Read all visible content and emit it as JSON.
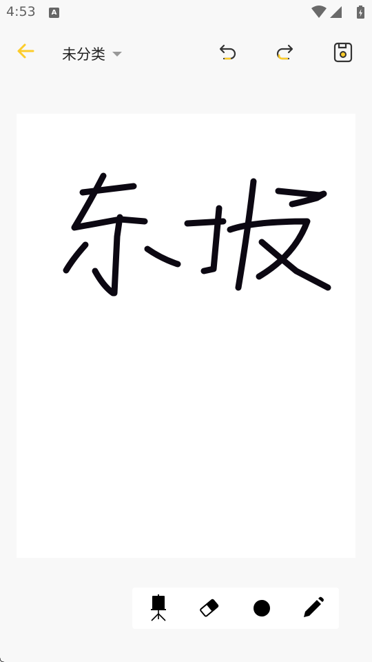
{
  "status_bar": {
    "time": "4:53",
    "notification_icon": "a-icon",
    "notification_glyph": "A",
    "icons": [
      "wifi-icon",
      "signal-icon",
      "battery-charging-icon"
    ]
  },
  "toolbar": {
    "back_icon": "arrow-left-icon",
    "category_label": "未分类",
    "category_icon": "caret-down-icon",
    "undo_icon": "undo-icon",
    "redo_icon": "redo-icon",
    "save_icon": "save-icon"
  },
  "canvas": {
    "content_description_icon": "handwriting-strokes",
    "stroke_color": "#0c0812"
  },
  "tools": [
    {
      "name": "easel-tool-icon"
    },
    {
      "name": "eraser-tool-icon"
    },
    {
      "name": "brush-size-icon"
    },
    {
      "name": "pen-tool-icon"
    }
  ],
  "colors": {
    "accent": "#fccc2a",
    "background": "#f8f8f8",
    "canvas": "#ffffff",
    "icon": "#333333"
  }
}
